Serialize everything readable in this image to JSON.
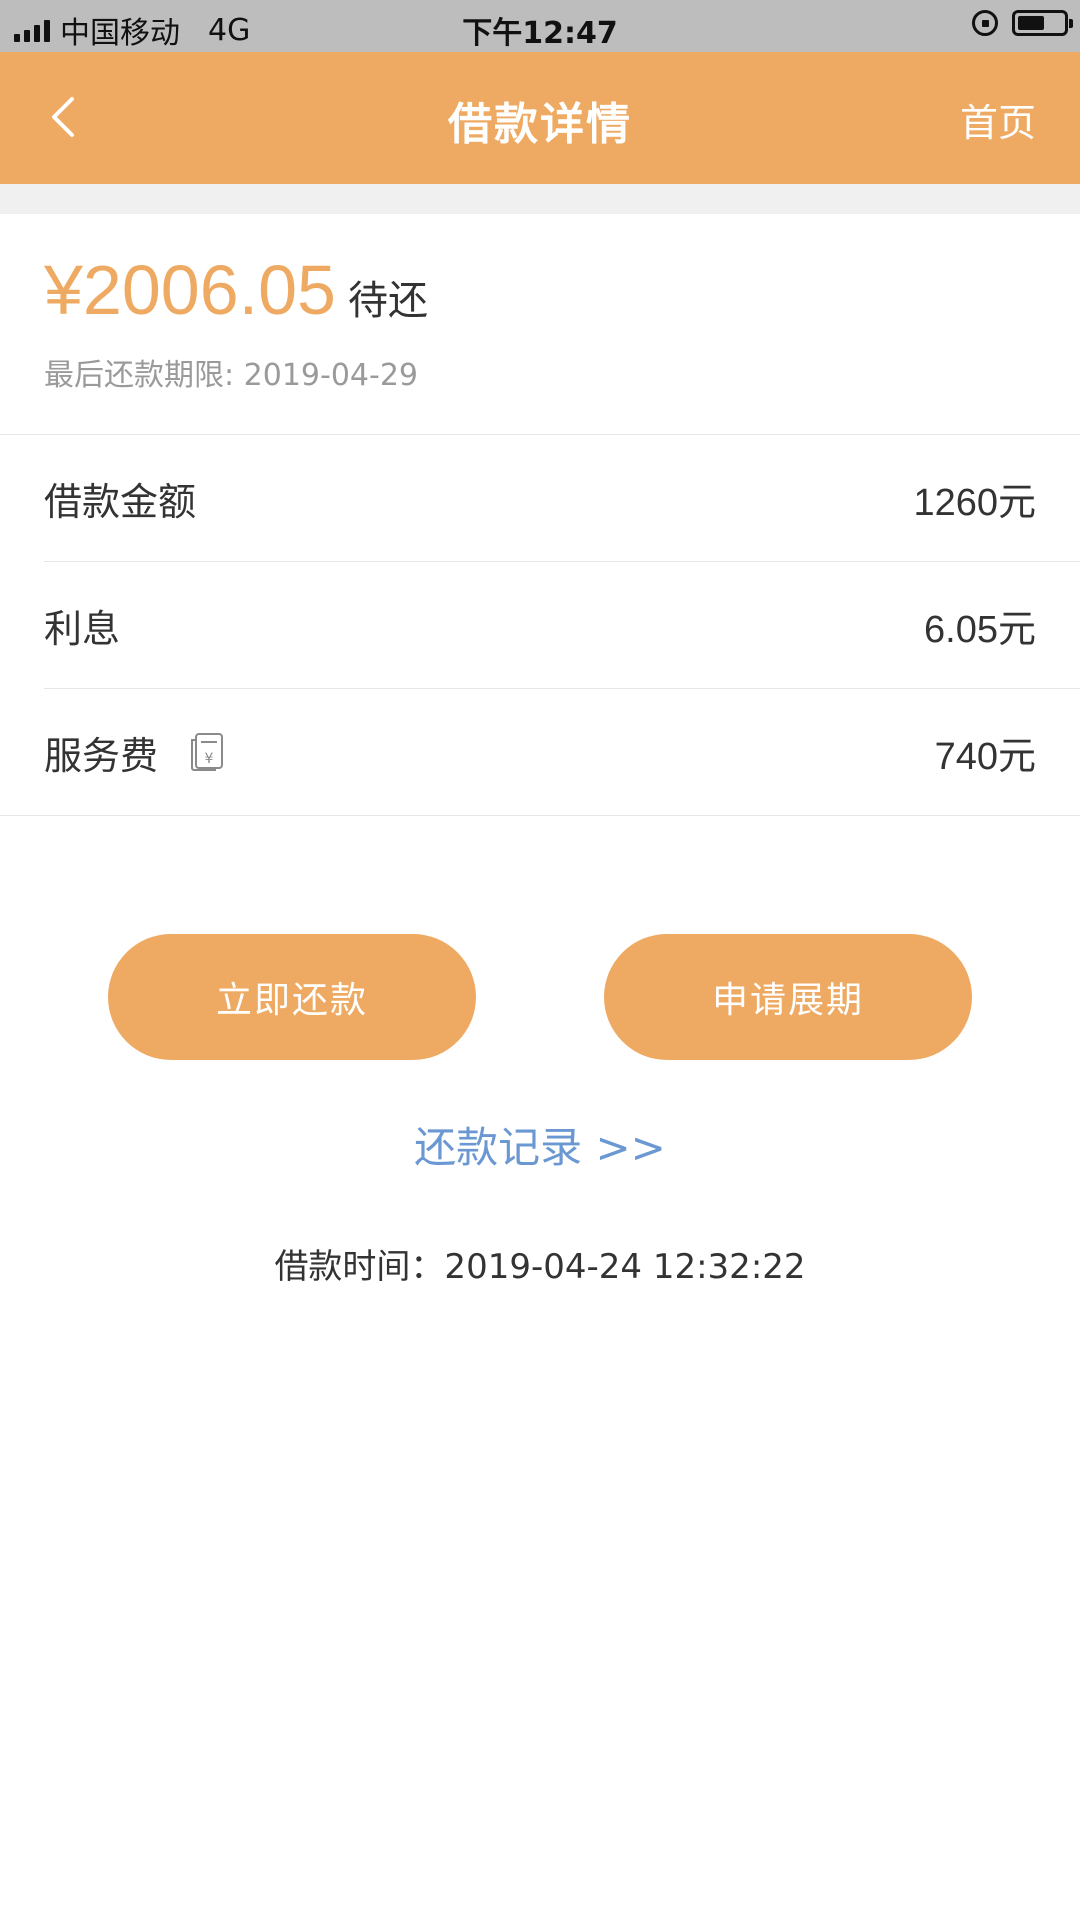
{
  "status_bar": {
    "carrier": "中国移动",
    "network": "4G",
    "time": "下午12:47"
  },
  "nav": {
    "title": "借款详情",
    "home_label": "首页",
    "bg_color": "#eeaa62"
  },
  "summary": {
    "amount": "¥2006.05",
    "status": "待还",
    "deadline": "最后还款期限: 2019-04-29"
  },
  "details": [
    {
      "label": "借款金额",
      "value": "1260元"
    },
    {
      "label": "利息",
      "value": "6.05元"
    },
    {
      "label": "服务费",
      "value": "740元",
      "icon": "receipt-icon"
    }
  ],
  "actions": {
    "repay_label": "立即还款",
    "extend_label": "申请展期"
  },
  "records_link": "还款记录 >>",
  "loan_time": "借款时间：2019-04-24 12:32:22",
  "colors": {
    "accent": "#eeaa62",
    "link": "#6b98d2",
    "muted": "#9a9a9a"
  }
}
